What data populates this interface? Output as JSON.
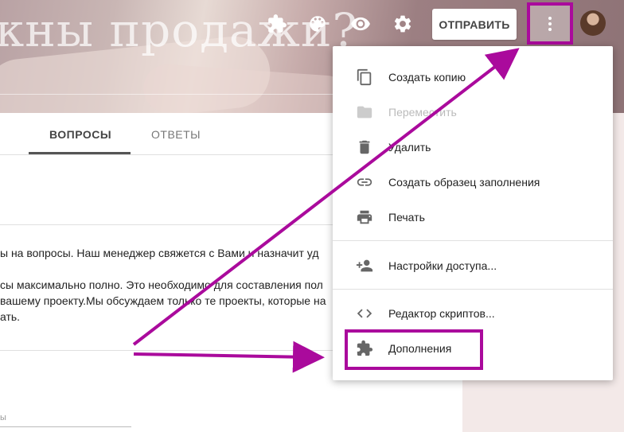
{
  "header": {
    "title": "кны продажи?",
    "send_label": "ОТПРАВИТЬ",
    "icons": [
      "addons-icon",
      "palette-icon",
      "preview-eye-icon",
      "settings-gear-icon",
      "more-vert-icon"
    ]
  },
  "tabs": [
    {
      "label": "ВОПРОСЫ",
      "active": true
    },
    {
      "label": "ОТВЕТЫ",
      "active": false
    }
  ],
  "form": {
    "description_lines": [
      "ы на вопросы. Наш менеджер свяжется с Вами и назначит уд",
      "сы максимально полно. Это необходимо для составления пол",
      "вашему проекту.Мы обсуждаем только те проекты, которые на",
      "ать."
    ],
    "hint": "ы"
  },
  "menu": {
    "items": [
      {
        "label": "Создать копию",
        "icon": "copy-icon",
        "disabled": false
      },
      {
        "label": "Переместить",
        "icon": "folder-icon",
        "disabled": true
      },
      {
        "label": "Удалить",
        "icon": "trash-icon",
        "disabled": false
      },
      {
        "label": "Создать образец заполнения",
        "icon": "link-icon",
        "disabled": false
      },
      {
        "label": "Печать",
        "icon": "print-icon",
        "disabled": false
      },
      {
        "label": "Настройки доступа...",
        "icon": "add-people-icon",
        "disabled": false
      },
      {
        "label": "Редактор скриптов...",
        "icon": "code-icon",
        "disabled": false
      },
      {
        "label": "Дополнения",
        "icon": "puzzle-icon",
        "disabled": false
      }
    ]
  },
  "colors": {
    "annotation": "#aa0a9c",
    "header_tint": "#b9a2a4"
  }
}
